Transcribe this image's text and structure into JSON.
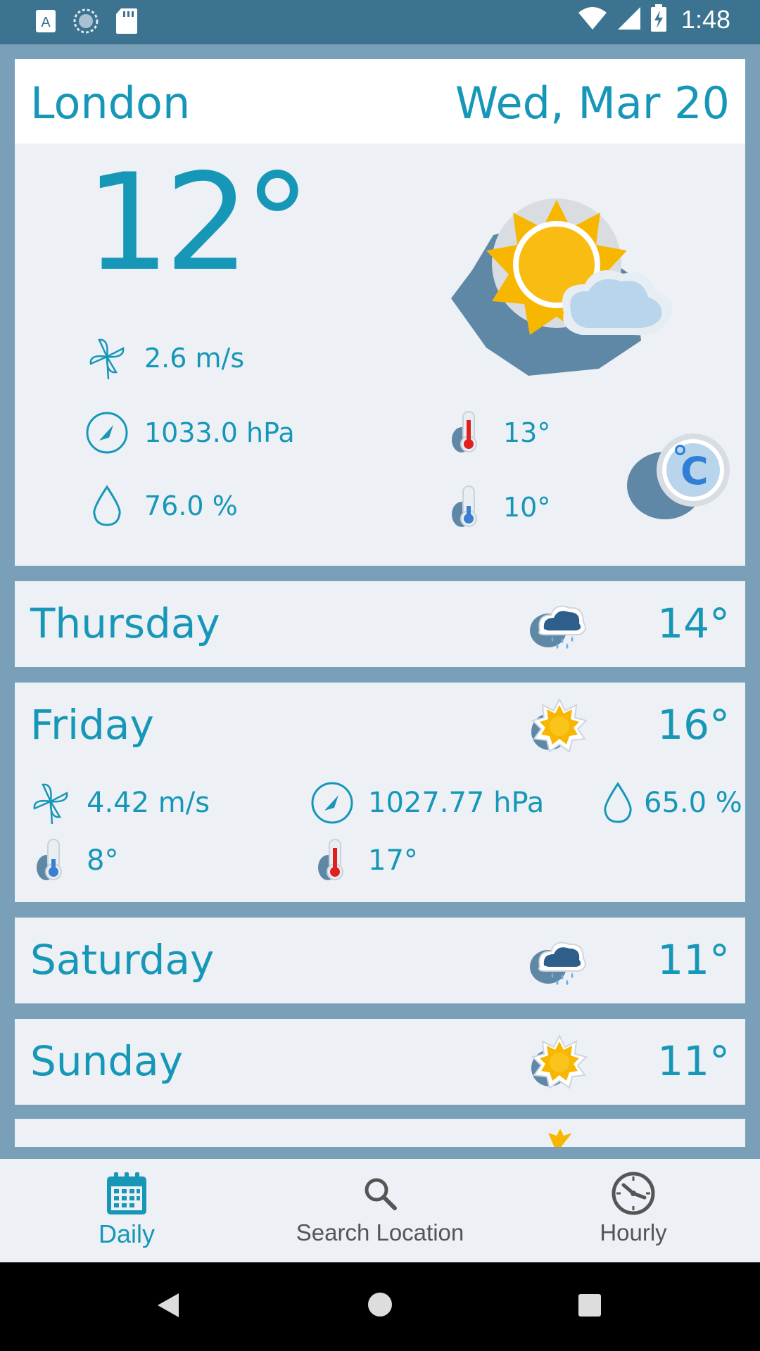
{
  "status_bar": {
    "time": "1:48",
    "icons": [
      "a-notification-icon",
      "sync-icon",
      "sd-card-icon",
      "wifi-icon",
      "signal-icon",
      "battery-charging-icon"
    ]
  },
  "today": {
    "city": "London",
    "date": "Wed, Mar 20",
    "temperature": "12°",
    "wind": "2.6 m/s",
    "pressure": "1033.0 hPa",
    "humidity": "76.0 %",
    "temp_max": "13°",
    "temp_min": "10°",
    "condition_icon": "sun-cloud-icon",
    "unit_button": "C"
  },
  "forecast": [
    {
      "day": "Thursday",
      "temp": "14°",
      "icon": "rain-cloud-icon"
    },
    {
      "day": "Friday",
      "temp": "16°",
      "icon": "sun-icon",
      "wind": "4.42 m/s",
      "pressure": "1027.77 hPa",
      "humidity": "65.0 %",
      "min": "8°",
      "max": "17°"
    },
    {
      "day": "Saturday",
      "temp": "11°",
      "icon": "rain-cloud-icon"
    },
    {
      "day": "Sunday",
      "temp": "11°",
      "icon": "sun-icon"
    }
  ],
  "bottom_nav": {
    "daily": "Daily",
    "search": "Search Location",
    "hourly": "Hourly",
    "active_color": "#1797b8",
    "inactive_color": "#555555"
  }
}
